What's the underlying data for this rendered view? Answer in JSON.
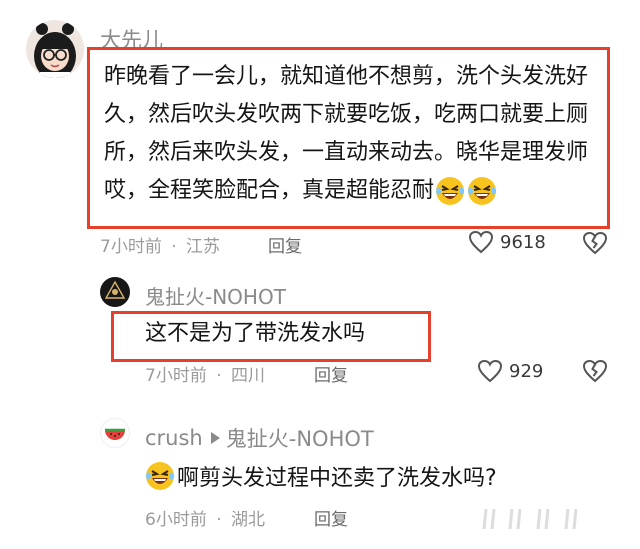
{
  "comments": [
    {
      "username": "大先儿",
      "text": "昨晚看了一会儿，就知道他不想剪，洗个头发洗好久，然后吹头发吹两下就要吃饭，吃两口就要上厕所，然后来吹头发，一直动来动去。晓华是理发师哎，全程笑脸配合，真是超能忍耐",
      "time": "7小时前",
      "location": "江苏",
      "reply_label": "回复",
      "likes": "9618"
    },
    {
      "username": "鬼扯火-NOHOT",
      "text": "这不是为了带洗发水吗",
      "time": "7小时前",
      "location": "四川",
      "reply_label": "回复",
      "likes": "929"
    },
    {
      "username": "crush",
      "reply_to": "鬼扯火-NOHOT",
      "text": "啊剪头发过程中还卖了洗发水吗?",
      "time": "6小时前",
      "location": "湖北",
      "reply_label": "回复"
    }
  ],
  "separator": "·",
  "icons": {
    "like": "heart-outline-icon",
    "dislike": "broken-heart-icon",
    "emoji": "laughing-sweat-emoji-icon",
    "reply_arrow": "play-triangle-icon"
  },
  "colors": {
    "highlight": "#e4402b",
    "emoji_yellow": "#f7c41f"
  }
}
